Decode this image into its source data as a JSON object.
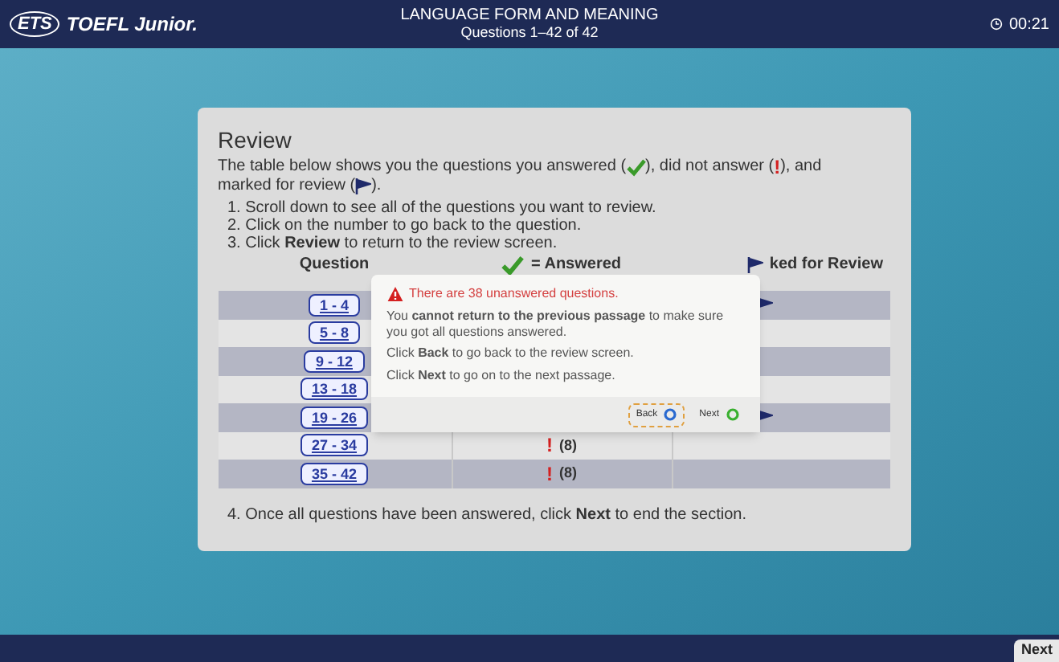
{
  "header": {
    "logo": "ETS",
    "brand": "TOEFL Junior.",
    "title": "LANGUAGE FORM AND MEANING",
    "subtitle": "Questions 1–42 of 42",
    "timer": "00:21"
  },
  "review": {
    "title": "Review",
    "intro": [
      [
        {
          "kind": "text",
          "text": "The table below shows you the questions you answered ("
        },
        {
          "kind": "check"
        },
        {
          "kind": "text",
          "text": "), did not answer ("
        },
        {
          "kind": "alert",
          "text": "!"
        },
        {
          "kind": "text",
          "text": "), and"
        }
      ],
      [
        {
          "kind": "text",
          "text": "marked for review ("
        },
        {
          "kind": "flag"
        },
        {
          "kind": "text",
          "text": ")."
        }
      ]
    ],
    "steps": [
      "1. Scroll down to see all of the questions you want to review.",
      "2. Click on the number to go back to the question.",
      "3. Click **Review** to return to the review screen."
    ],
    "columns": [
      {
        "kind": "text",
        "text": "Question"
      },
      {
        "kind": "check",
        "text": "= Answered"
      },
      {
        "kind": "flag",
        "text": "ked for Review"
      }
    ],
    "rows": [
      {
        "range": "1 - 4",
        "flagged": true
      },
      {
        "range": "5 - 8",
        "flagged": false
      },
      {
        "range": "9 - 12",
        "flagged": false
      },
      {
        "range": "13 - 18",
        "flagged": false
      },
      {
        "range": "19 - 26",
        "flagged": true
      },
      {
        "range": "27 - 34",
        "alert": "!",
        "count": "(8)",
        "flagged": false
      },
      {
        "range": "35 - 42",
        "alert": "!",
        "count": "(8)",
        "flagged": false
      }
    ],
    "final_step": "4. Once all questions have been answered, click **Next** to end the section."
  },
  "dialog": {
    "warning": "There are 38 unanswered questions.",
    "paragraphs": [
      "You **cannot return to the previous passage** to make sure you got all questions answered.",
      "Click **Back** to go back to the review screen.",
      "Click **Next** to go on to the next passage."
    ],
    "buttons": [
      {
        "label": "Back",
        "kind": "back",
        "focused": true
      },
      {
        "label": "Next",
        "kind": "next",
        "focused": false
      }
    ]
  },
  "footer": {
    "next_button": "Next"
  }
}
